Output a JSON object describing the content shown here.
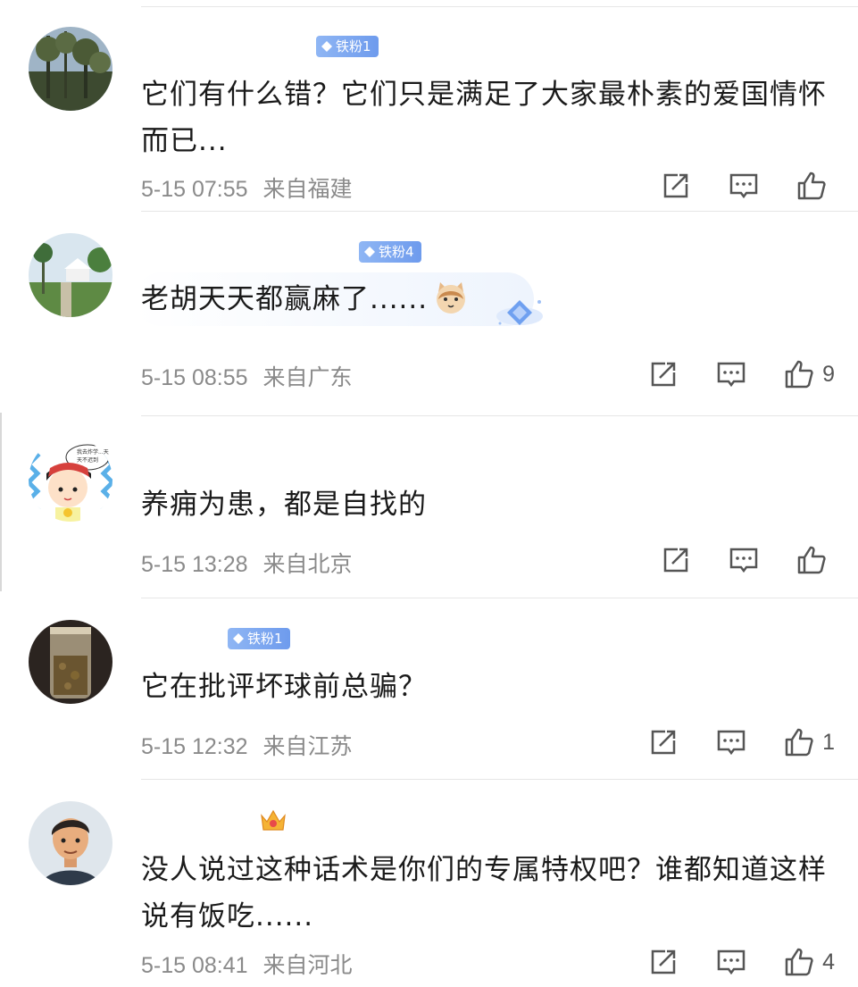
{
  "comments": [
    {
      "badge": "铁粉1",
      "text": "它们有什么错？它们只是满足了大家最朴素的爱国情怀而已...",
      "date": "5-15 07:55",
      "location": "来自福建",
      "likes": ""
    },
    {
      "badge": "铁粉4",
      "text": "老胡天天都赢麻了......",
      "date": "5-15 08:55",
      "location": "来自广东",
      "likes": "9"
    },
    {
      "badge": "",
      "text": "养痈为患，都是自找的",
      "date": "5-15 13:28",
      "location": "来自北京",
      "likes": ""
    },
    {
      "badge": "铁粉1",
      "text": "它在批评坏球前总骗？",
      "date": "5-15 12:32",
      "location": "来自江苏",
      "likes": "1"
    },
    {
      "badge": "",
      "text": "没人说过这种话术是你们的专属特权吧？谁都知道这样说有饭吃......",
      "date": "5-15 08:41",
      "location": "来自河北",
      "likes": "4"
    }
  ],
  "avatar3_caption": "我去炸学...天天不迟到",
  "icons": {
    "share": "share-icon",
    "comment": "comment-icon",
    "like": "thumbs-up-icon",
    "badge": "diamond-icon",
    "crown": "crown-icon",
    "sticker": "cat-sticker-icon"
  },
  "colors": {
    "badge": "#7aa5f0",
    "meta": "#8a8a8a",
    "text": "#1a1a1a"
  }
}
